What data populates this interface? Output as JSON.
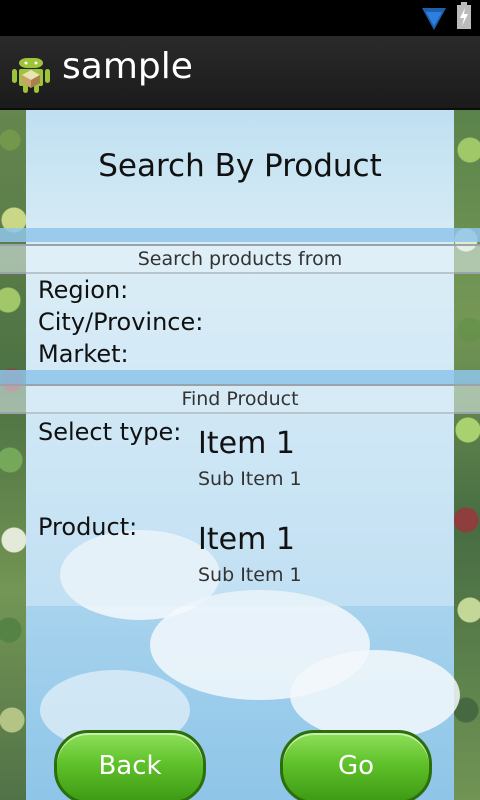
{
  "app": {
    "title": "sample"
  },
  "status_bar": {
    "wifi_icon": "wifi-icon",
    "battery_icon": "battery-icon"
  },
  "page": {
    "title": "Search By Product",
    "location_section": {
      "header": "Search products from",
      "fields": [
        "Region:",
        "City/Province:",
        "Market:"
      ]
    },
    "find_section": {
      "header": "Find Product",
      "type_label": "Select type:",
      "type_value": "Item 1",
      "type_sub": "Sub Item 1",
      "product_label": "Product:",
      "product_value": "Item 1",
      "product_sub": "Sub Item 1"
    },
    "buttons": {
      "back": "Back",
      "go": "Go"
    }
  }
}
